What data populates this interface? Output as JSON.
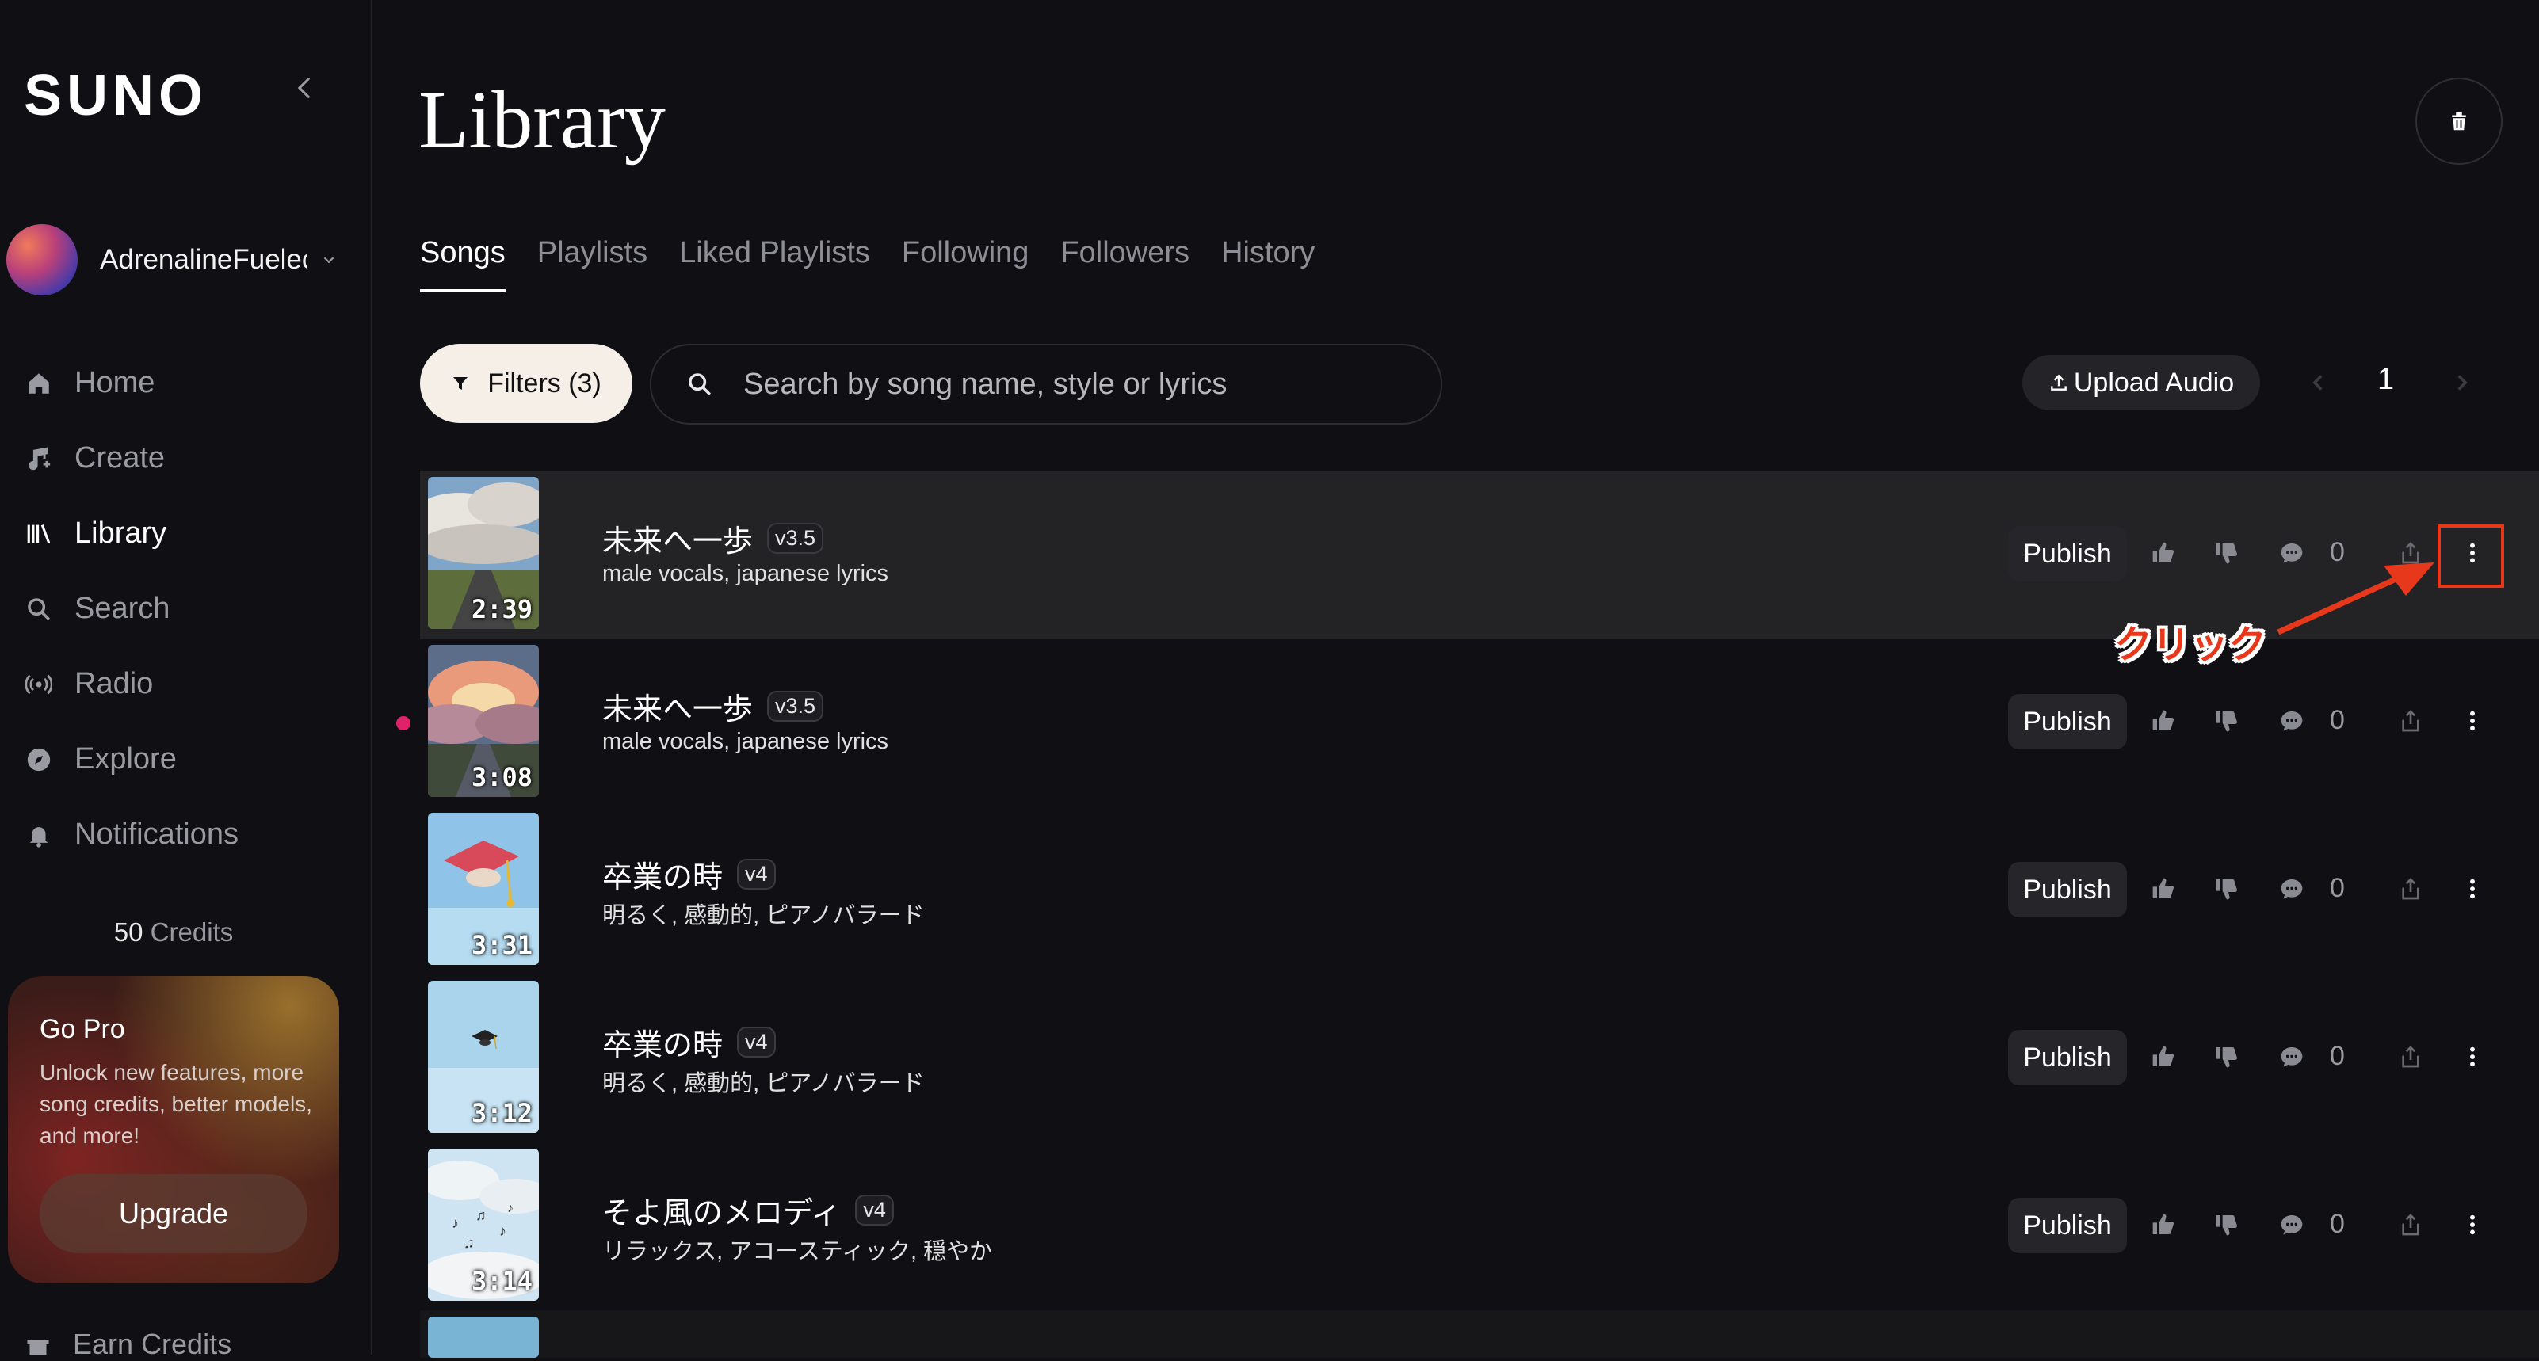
{
  "app": {
    "logo": "SUNO"
  },
  "user": {
    "name": "AdrenalineFuelec"
  },
  "nav": [
    {
      "label": "Home",
      "icon": "home-icon",
      "active": false
    },
    {
      "label": "Create",
      "icon": "music-note-icon",
      "active": false
    },
    {
      "label": "Library",
      "icon": "library-icon",
      "active": true
    },
    {
      "label": "Search",
      "icon": "search-icon",
      "active": false
    },
    {
      "label": "Radio",
      "icon": "radio-icon",
      "active": false
    },
    {
      "label": "Explore",
      "icon": "compass-icon",
      "active": false
    },
    {
      "label": "Notifications",
      "icon": "bell-icon",
      "active": false
    }
  ],
  "credits": {
    "amount": "50",
    "label": "Credits"
  },
  "gopro": {
    "title": "Go Pro",
    "text": "Unlock new features, more song credits, better models, and more!",
    "button": "Upgrade"
  },
  "earn_credits": "Earn Credits",
  "page": {
    "title": "Library"
  },
  "tabs": [
    {
      "label": "Songs",
      "active": true
    },
    {
      "label": "Playlists",
      "active": false
    },
    {
      "label": "Liked Playlists",
      "active": false
    },
    {
      "label": "Following",
      "active": false
    },
    {
      "label": "Followers",
      "active": false
    },
    {
      "label": "History",
      "active": false
    }
  ],
  "toolbar": {
    "filters_label": "Filters (3)",
    "search_placeholder": "Search by song name, style or lyrics",
    "upload_label": "Upload Audio",
    "page_number": "1"
  },
  "songs": [
    {
      "title": "未来へ一歩",
      "version": "v3.5",
      "style": "male vocals, japanese lyrics",
      "duration": "2:39",
      "publish": "Publish",
      "comments": "0",
      "highlight": true,
      "new_dot": false,
      "thumb": "clouds-road"
    },
    {
      "title": "未来へ一歩",
      "version": "v3.5",
      "style": "male vocals, japanese lyrics",
      "duration": "3:08",
      "publish": "Publish",
      "comments": "0",
      "highlight": false,
      "new_dot": true,
      "thumb": "sunset-road"
    },
    {
      "title": "卒業の時",
      "version": "v4",
      "style": "明るく, 感動的, ピアノバラード",
      "duration": "3:31",
      "publish": "Publish",
      "comments": "0",
      "highlight": false,
      "new_dot": false,
      "thumb": "grad-cap-red"
    },
    {
      "title": "卒業の時",
      "version": "v4",
      "style": "明るく, 感動的, ピアノバラード",
      "duration": "3:12",
      "publish": "Publish",
      "comments": "0",
      "highlight": false,
      "new_dot": false,
      "thumb": "grad-cap-black"
    },
    {
      "title": "そよ風のメロディ",
      "version": "v4",
      "style": "リラックス, アコースティック, 穏やか",
      "duration": "3:14",
      "publish": "Publish",
      "comments": "0",
      "highlight": false,
      "new_dot": false,
      "thumb": "music-notes-sky"
    }
  ],
  "annotation": {
    "text": "クリック",
    "color": "#e8381c"
  },
  "colors": {
    "background": "#101014",
    "accent_dot": "#e0226a",
    "filters_bg": "#f5efe7"
  }
}
